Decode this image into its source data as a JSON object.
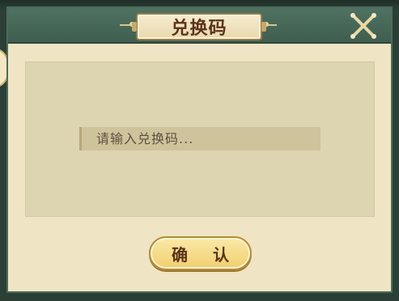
{
  "dialog": {
    "title": "兑换码",
    "close_icon": "close-x-icon"
  },
  "redeem": {
    "placeholder": "请输入兑换码...",
    "value": ""
  },
  "confirm": {
    "label": "确 认"
  },
  "colors": {
    "header": "#4a6b5b",
    "panel_bg": "#efe5c4",
    "input_bg": "#cfc39c",
    "button_gold": "#f3d67f",
    "title_text": "#5a3317"
  }
}
